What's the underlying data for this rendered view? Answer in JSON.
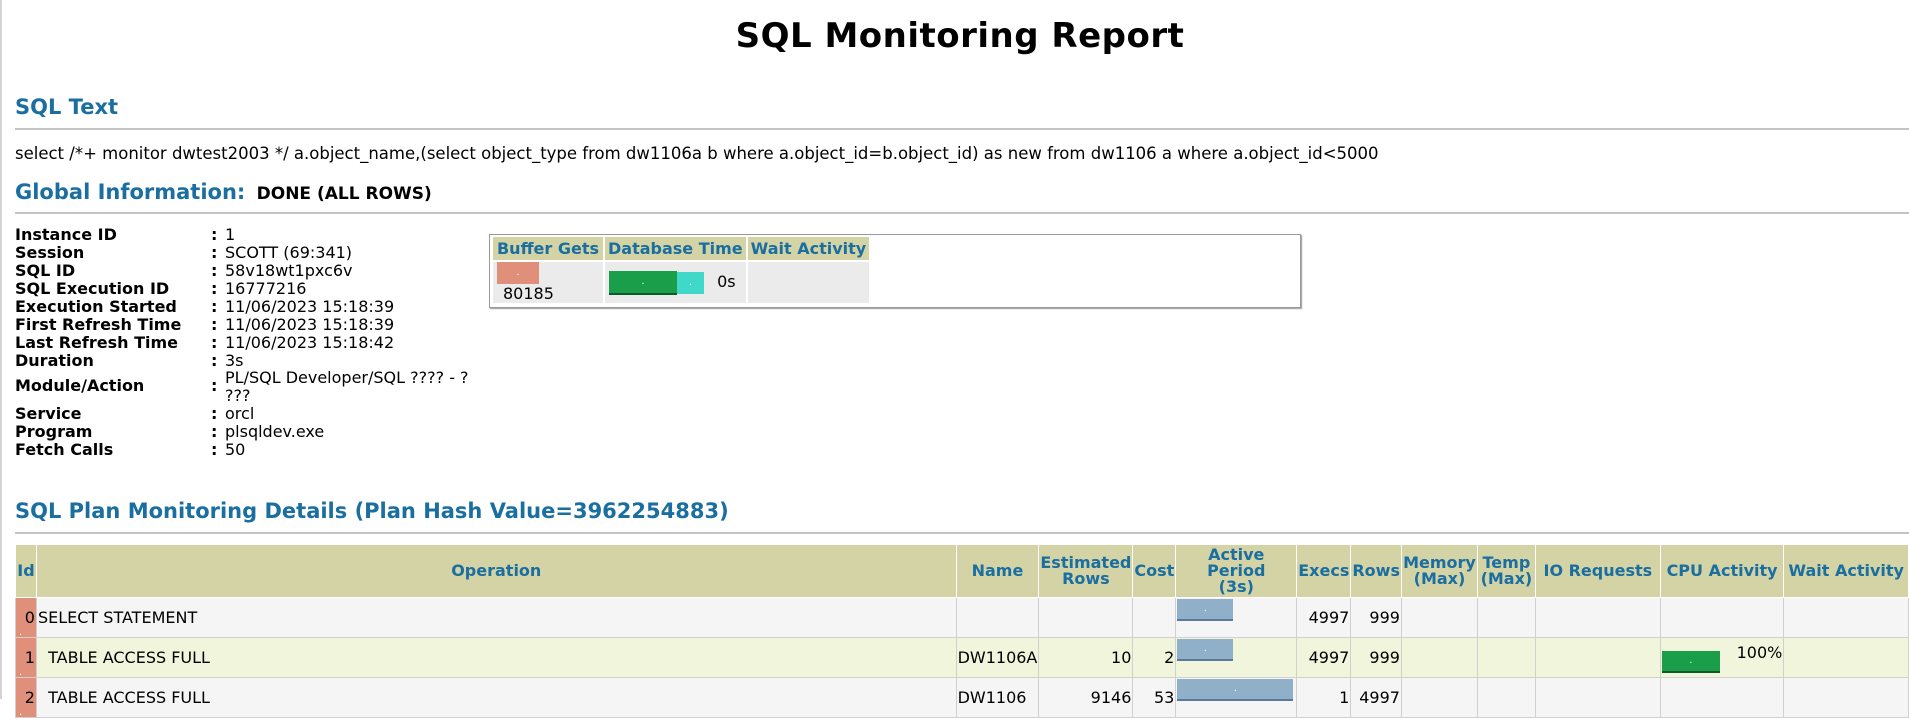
{
  "report": {
    "title": "SQL Monitoring Report"
  },
  "sql_text": {
    "heading": "SQL Text",
    "text": "select /*+ monitor dwtest2003 */ a.object_name,(select object_type from dw1106a b where a.object_id=b.object_id) as new from dw1106 a where a.object_id<5000"
  },
  "global": {
    "heading": "Global Information:",
    "status": "DONE (ALL ROWS)",
    "rows": [
      {
        "label": "Instance ID",
        "value": "1"
      },
      {
        "label": "Session",
        "value": "SCOTT (69:341)"
      },
      {
        "label": "SQL ID",
        "value": "58v18wt1pxc6v"
      },
      {
        "label": "SQL Execution ID",
        "value": "16777216"
      },
      {
        "label": "Execution Started",
        "value": "11/06/2023 15:18:39"
      },
      {
        "label": "First Refresh Time",
        "value": "11/06/2023 15:18:39"
      },
      {
        "label": "Last Refresh Time",
        "value": "11/06/2023 15:18:42"
      },
      {
        "label": "Duration",
        "value": "3s"
      },
      {
        "label": "Module/Action",
        "value": "PL/SQL Developer/SQL ???? - ?",
        "value2": "???"
      },
      {
        "label": "Service",
        "value": "orcl"
      },
      {
        "label": "Program",
        "value": "plsqldev.exe"
      },
      {
        "label": "Fetch Calls",
        "value": "50"
      }
    ],
    "colon": ":"
  },
  "stats": {
    "headers": [
      "Buffer Gets",
      "Database Time",
      "Wait Activity"
    ],
    "buffer_gets": "80185",
    "database_time": "0s",
    "wait_activity": "",
    "bar_dot": "."
  },
  "plan": {
    "heading": "SQL Plan Monitoring Details (Plan Hash Value=3962254883)",
    "headers": {
      "id": "Id",
      "operation": "Operation",
      "name": "Name",
      "est_rows_1": "Estimated",
      "est_rows_2": "Rows",
      "cost": "Cost",
      "active_1": "Active Period",
      "active_2": "(3s)",
      "execs": "Execs",
      "rows": "Rows",
      "mem_1": "Memory",
      "mem_2": "(Max)",
      "temp_1": "Temp",
      "temp_2": "(Max)",
      "io": "IO Requests",
      "cpu": "CPU Activity",
      "wait": "Wait Activity"
    },
    "rows": [
      {
        "id": "0",
        "operation": "SELECT STATEMENT",
        "name": "",
        "est_rows": "",
        "cost": "",
        "active_fraction": 0.5,
        "active_offset": 0.0,
        "execs": "4997",
        "rows": "999",
        "cpu": ""
      },
      {
        "id": "1",
        "operation": "TABLE ACCESS FULL",
        "name": "DW1106A",
        "est_rows": "10",
        "cost": "2",
        "active_fraction": 0.5,
        "active_offset": 0.0,
        "execs": "4997",
        "rows": "999",
        "cpu": "100%"
      },
      {
        "id": "2",
        "operation": "TABLE ACCESS FULL",
        "name": "DW1106",
        "est_rows": "9146",
        "cost": "53",
        "active_fraction": 1.0,
        "active_offset": 0.0,
        "execs": "1",
        "rows": "4997",
        "cpu": ""
      }
    ],
    "dot": "."
  },
  "colors": {
    "heading": "#1a6ea0",
    "header_bg": "#d3d3a6",
    "id_cell": "#e0907a",
    "buffer_bar": "#e0907a",
    "db_time_green": "#1a9e4a",
    "db_time_cyan": "#40d8c8",
    "active_bar": "#8fb0c8",
    "cpu_bar": "#1a9e4a"
  }
}
